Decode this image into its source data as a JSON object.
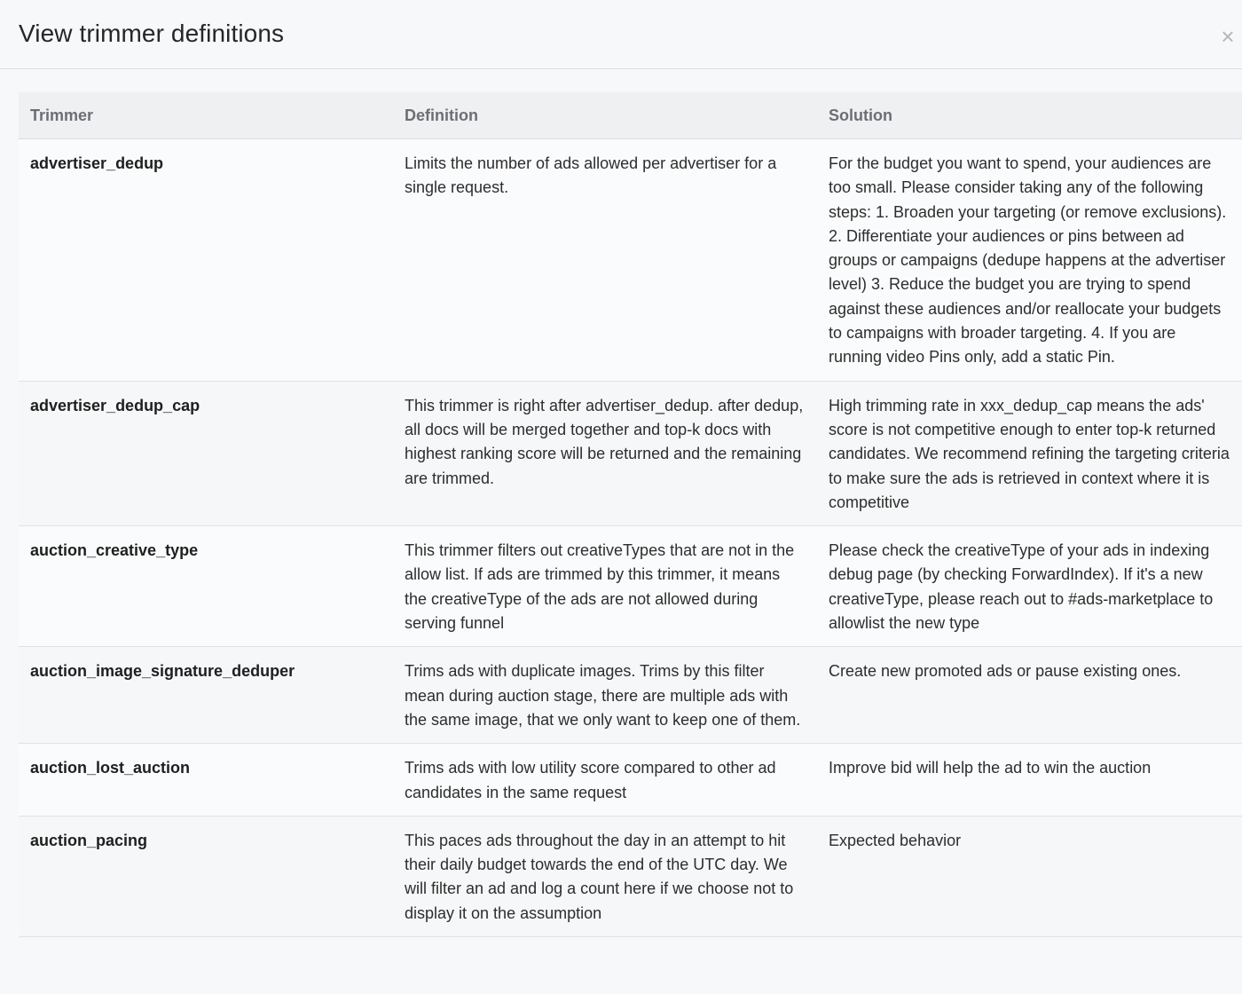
{
  "modal": {
    "title": "View trimmer definitions",
    "close_glyph": "×"
  },
  "table": {
    "columns": [
      "Trimmer",
      "Definition",
      "Solution"
    ],
    "rows": [
      {
        "trimmer": "advertiser_dedup",
        "definition": "Limits the number of ads allowed per advertiser for a single request.",
        "solution": "For the budget you want to spend, your audiences are too small. Please consider taking any of the following steps: 1. Broaden your targeting (or remove exclusions). 2. Differentiate your audiences or pins between ad groups or campaigns (dedupe happens at the advertiser level) 3. Reduce the budget you are trying to spend against these audiences and/or reallocate your budgets to campaigns with broader targeting. 4. If you are running video Pins only, add a static Pin."
      },
      {
        "trimmer": "advertiser_dedup_cap",
        "definition": "This trimmer is right after advertiser_dedup. after dedup, all docs will be merged together and top-k docs with highest ranking score will be returned and the remaining are trimmed.",
        "solution": "High trimming rate in xxx_dedup_cap means the ads' score is not competitive enough to enter top-k returned candidates. We recommend refining the targeting criteria to make sure the ads is retrieved in context where it is competitive"
      },
      {
        "trimmer": "auction_creative_type",
        "definition": "This trimmer filters out creativeTypes that are not in the allow list. If ads are trimmed by this trimmer, it means the creativeType of the ads are not allowed during serving funnel",
        "solution": "Please check the creativeType of your ads in indexing debug page (by checking ForwardIndex). If it's a new creativeType, please reach out to #ads-marketplace to allowlist the new type"
      },
      {
        "trimmer": "auction_image_signature_deduper",
        "definition": "Trims ads with duplicate images. Trims by this filter mean during auction stage, there are multiple ads with the same image, that we only want to keep one of them.",
        "solution": "Create new promoted ads or pause existing ones."
      },
      {
        "trimmer": "auction_lost_auction",
        "definition": "Trims ads with low utility score compared to other ad candidates in the same request",
        "solution": "Improve bid will help the ad to win the auction"
      },
      {
        "trimmer": "auction_pacing",
        "definition": "This paces ads throughout the day in an attempt to hit their daily budget towards the end of the UTC day. We will filter an ad and log a count here if we choose not to display it on the assumption",
        "solution": "Expected behavior"
      }
    ]
  }
}
